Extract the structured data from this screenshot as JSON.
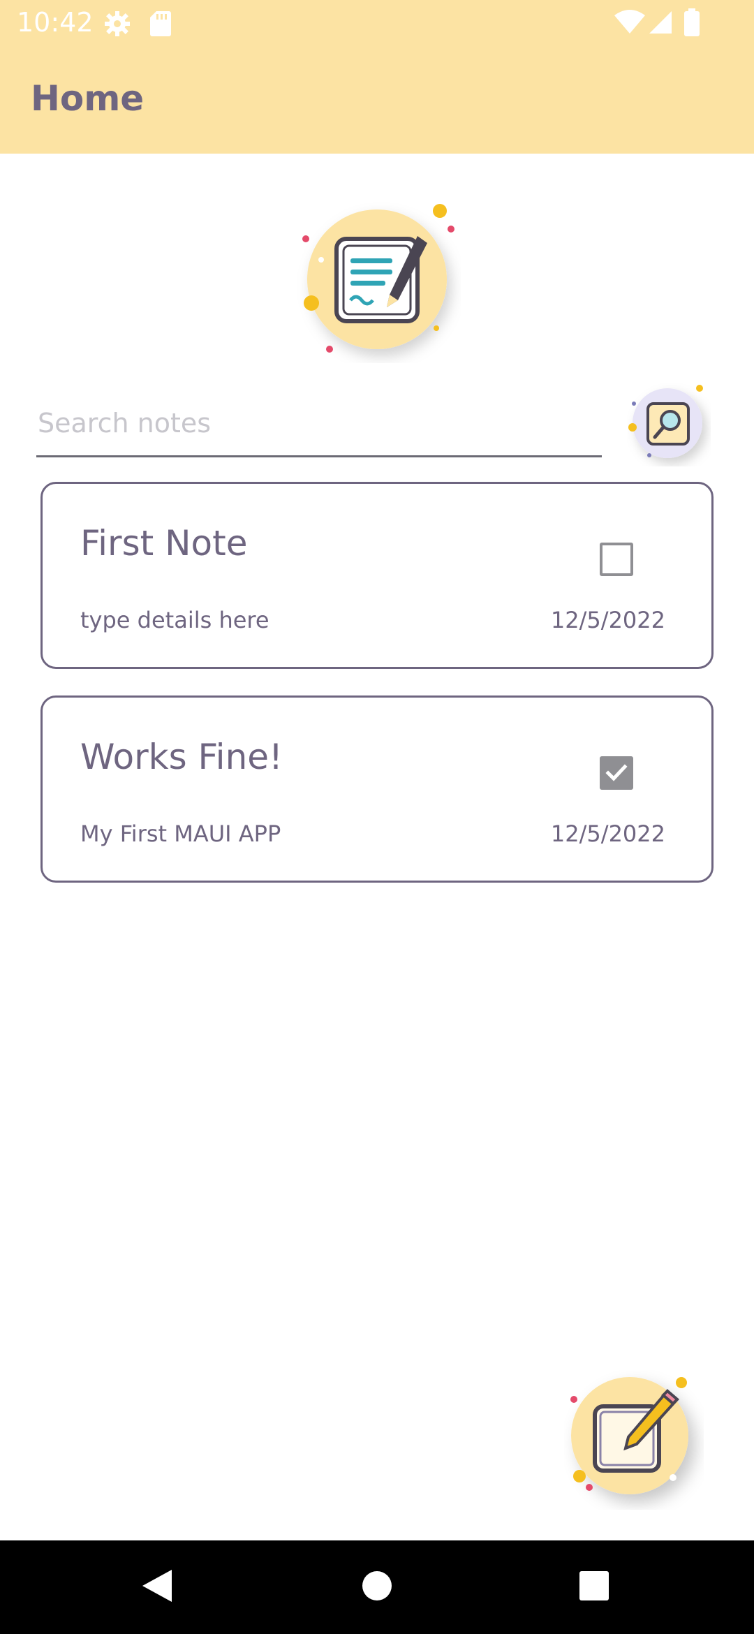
{
  "status_bar": {
    "time": "10:42",
    "icons": [
      "settings-icon",
      "sd-card-icon",
      "wifi-icon",
      "signal-icon",
      "battery-icon"
    ]
  },
  "app_bar": {
    "title": "Home",
    "color": "#fce3a3"
  },
  "search": {
    "placeholder": "Search notes",
    "value": ""
  },
  "notes": [
    {
      "title": "First Note",
      "details": "type details here",
      "date": "12/5/2022",
      "checked": false
    },
    {
      "title": "Works Fine!",
      "details": "My First MAUI APP",
      "date": "12/5/2022",
      "checked": true
    }
  ],
  "colors": {
    "accent": "#fce3a3",
    "text": "#6e6580",
    "checkbox": "#8f8f93"
  },
  "nav_bar": {
    "buttons": [
      "back-icon",
      "home-icon",
      "recents-icon"
    ]
  }
}
